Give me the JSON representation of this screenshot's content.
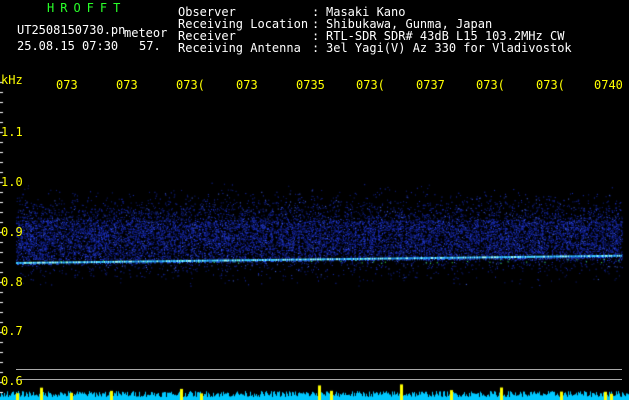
{
  "header": {
    "app_name": "HROFFT",
    "file_name": "UT2508150730.pn",
    "file_tag": "meteor",
    "date_time": "25.08.15 07:30",
    "count": "57."
  },
  "metadata": [
    {
      "label": "Observer",
      "sep": ":",
      "value": "Masaki Kano"
    },
    {
      "label": "Receiving Location",
      "sep": ":",
      "value": "Shibukawa, Gunma, Japan"
    },
    {
      "label": "Receiver",
      "sep": ":",
      "value": "RTL-SDR SDR# 43dB L15 103.2MHz CW"
    },
    {
      "label": "Receiving Antenna",
      "sep": ":",
      "value": "3el Yagi(V) Az 330 for Vladivostok"
    }
  ],
  "axis": {
    "unit": "kHz",
    "freq_ticks": [
      "1.1",
      "1.0",
      "0.9",
      "0.8",
      "0.7",
      "0.6"
    ],
    "time_ticks": [
      "073",
      "073",
      "073(",
      "073",
      "0735",
      "073(",
      "0737",
      "073(",
      "073(",
      "0740"
    ]
  },
  "colors": {
    "label_green": "#29ff29",
    "label_white": "#ffffff",
    "time_yellow": "#ffff00",
    "background": "#000000",
    "signal_cyan": "#40d0ff",
    "noise_blue": "#1a30c8",
    "power_cyan": "#00c8ff",
    "power_yellow": "#ffff00"
  }
}
